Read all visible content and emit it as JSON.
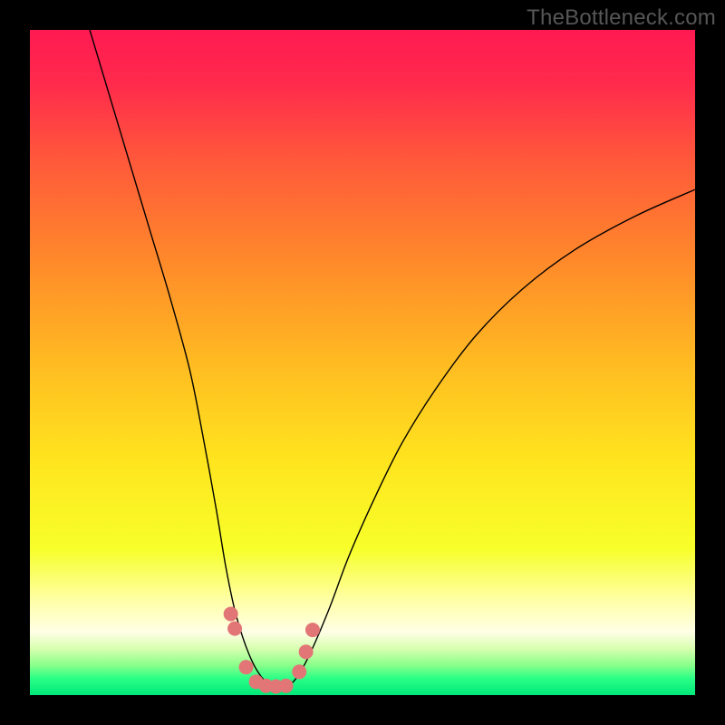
{
  "watermark": "TheBottleneck.com",
  "chart_data": {
    "type": "line",
    "title": "",
    "xlabel": "",
    "ylabel": "",
    "xlim": [
      0,
      100
    ],
    "ylim": [
      0,
      100
    ],
    "grid": false,
    "legend": false,
    "background_gradient": {
      "stops": [
        {
          "pos": 0.0,
          "color": "#ff1a52"
        },
        {
          "pos": 0.08,
          "color": "#ff2a4c"
        },
        {
          "pos": 0.2,
          "color": "#ff5a3a"
        },
        {
          "pos": 0.35,
          "color": "#ff8a2a"
        },
        {
          "pos": 0.5,
          "color": "#ffbb22"
        },
        {
          "pos": 0.65,
          "color": "#ffe51e"
        },
        {
          "pos": 0.78,
          "color": "#f7ff2a"
        },
        {
          "pos": 0.86,
          "color": "#ffffaa"
        },
        {
          "pos": 0.905,
          "color": "#ffffe6"
        },
        {
          "pos": 0.93,
          "color": "#d8ffb0"
        },
        {
          "pos": 0.955,
          "color": "#8aff8a"
        },
        {
          "pos": 0.975,
          "color": "#2aff86"
        },
        {
          "pos": 1.0,
          "color": "#00e87a"
        }
      ]
    },
    "series": [
      {
        "name": "bottleneck-curve",
        "color": "#000000",
        "width": 1.4,
        "x": [
          9,
          12,
          15,
          18,
          21,
          24,
          26,
          28,
          29.5,
          31,
          33,
          35,
          37,
          38.5,
          40,
          42,
          45,
          48,
          52,
          56,
          61,
          67,
          74,
          82,
          91,
          100
        ],
        "values": [
          100,
          90,
          80,
          70,
          60,
          49,
          39,
          28,
          19,
          12,
          6,
          2.5,
          1.3,
          1.3,
          2.5,
          6,
          13,
          21,
          30,
          38,
          46,
          54,
          61,
          67,
          72,
          76
        ]
      },
      {
        "name": "dot-markers",
        "type": "scatter",
        "color": "#e27676",
        "radius": 8,
        "x": [
          30.2,
          30.8,
          32.5,
          34.0,
          35.5,
          37.0,
          38.5,
          40.5,
          41.5,
          42.5
        ],
        "values": [
          12.2,
          10.0,
          4.2,
          2.0,
          1.4,
          1.3,
          1.4,
          3.5,
          6.5,
          9.8
        ]
      }
    ]
  }
}
